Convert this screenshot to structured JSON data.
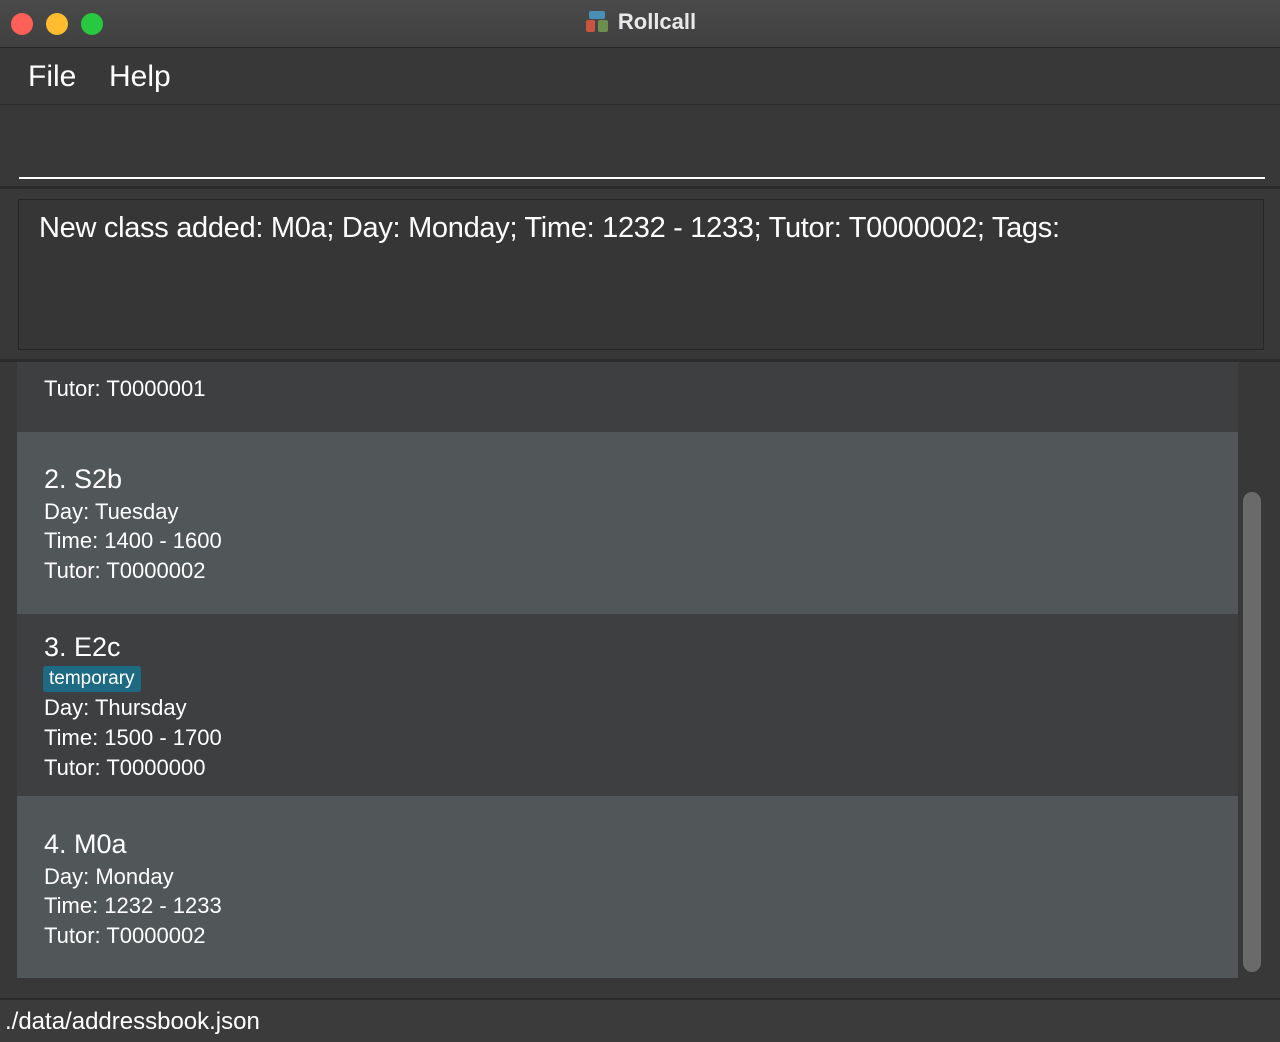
{
  "window": {
    "title": "Rollcall"
  },
  "menu": {
    "file": "File",
    "help": "Help"
  },
  "command": {
    "value": "",
    "placeholder": ""
  },
  "result": {
    "text": "New class added: M0a; Day: Monday; Time: 1232 - 1233; Tutor: T0000002; Tags:"
  },
  "classes": [
    {
      "tutor": "Tutor: T0000001"
    },
    {
      "name": "2. S2b",
      "day": "Day: Tuesday",
      "time": "Time: 1400 - 1600",
      "tutor": "Tutor: T0000002"
    },
    {
      "name": "3. E2c",
      "tag": "temporary",
      "day": "Day: Thursday",
      "time": "Time: 1500 - 1700",
      "tutor": "Tutor: T0000000"
    },
    {
      "name": "4. M0a",
      "day": "Day: Monday",
      "time": "Time: 1232 - 1233",
      "tutor": "Tutor: T0000002"
    }
  ],
  "status": {
    "path": "./data/addressbook.json"
  },
  "colors": {
    "tag_bg": "#1e6a83",
    "card_dark": "#3d3f41",
    "card_light": "#515658",
    "background": "#383838"
  }
}
